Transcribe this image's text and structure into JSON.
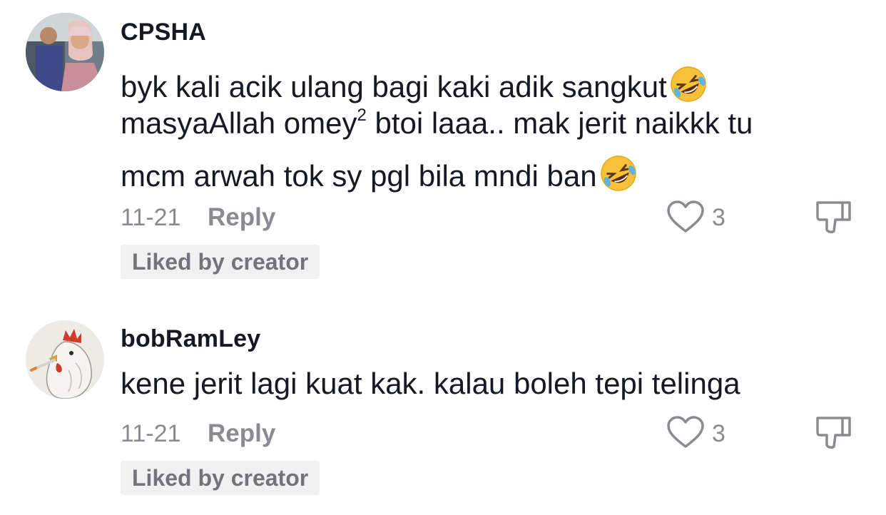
{
  "comments": [
    {
      "username": "CPSHA",
      "text_lines": [
        "byk kali acik ulang bagi kaki adik sangkut",
        "masyaAllah omey",
        "2",
        " btoi laaa.. mak jerit naikkk tu",
        "mcm arwah tok sy pgl bila mndi ban"
      ],
      "emoji": "rolling-on-the-floor-laughing",
      "date": "11-21",
      "reply_label": "Reply",
      "like_count": "3",
      "badge": "Liked by creator"
    },
    {
      "username": "bobRamLey",
      "text_lines": [
        "kene jerit lagi kuat kak. kalau boleh tepi telinga"
      ],
      "date": "11-21",
      "reply_label": "Reply",
      "like_count": "3",
      "badge": "Liked by creator"
    }
  ],
  "icons": {
    "like": "heart-outline-icon",
    "dislike": "thumbs-down-icon",
    "emoji": "rofl-emoji-icon"
  },
  "colors": {
    "primary_text": "#161823",
    "secondary_text": "#8a8b91",
    "badge_bg": "#f1f1f2",
    "badge_text": "#73747b"
  }
}
